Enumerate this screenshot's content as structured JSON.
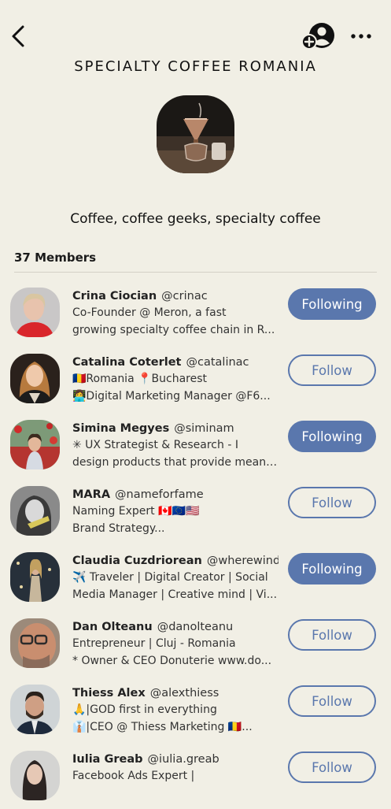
{
  "header": {
    "back_icon": "chevron-left-icon",
    "add_person_icon": "add-person-icon",
    "more_icon": "more-horizontal-icon"
  },
  "club": {
    "title": "SPECIALTY COFFEE ROMANIA",
    "description": "Coffee, coffee geeks, specialty coffee"
  },
  "members_count_label": "37 Members",
  "colors": {
    "accent": "#5a77ad",
    "background": "#f1efe5"
  },
  "members": [
    {
      "name": "Crina Ciocian",
      "handle": "@crinac",
      "bio1": "Co-Founder @ Meron, a fast",
      "bio2": "growing specialty coffee chain in R...",
      "button": "Following",
      "following": true
    },
    {
      "name": "Catalina Coterlet",
      "handle": "@catalinac",
      "bio1": "🇷🇴Romania 📍Bucharest",
      "bio2": "👩‍💻Digital Marketing Manager @F6...",
      "button": "Follow",
      "following": false
    },
    {
      "name": "Simina Megyes",
      "handle": "@siminam",
      "bio1": "✳ UX Strategist & Research - I",
      "bio2": "design products that provide meani...",
      "button": "Following",
      "following": true
    },
    {
      "name": "MARA",
      "handle": "@nameforfame",
      "bio1": "Naming Expert 🇨🇦🇪🇺🇺🇸",
      "bio2": "Brand Strategy...",
      "button": "Follow",
      "following": false
    },
    {
      "name": "Claudia Cuzdriorean",
      "handle": "@wherewinds",
      "bio1": "✈️ Traveler | Digital Creator | Social",
      "bio2": "Media Manager | Creative mind | Vi...",
      "button": "Following",
      "following": true
    },
    {
      "name": "Dan Olteanu",
      "handle": "@danolteanu",
      "bio1": "Entrepreneur | Cluj - Romania",
      "bio2": "* Owner & CEO Donuterie www.do...",
      "button": "Follow",
      "following": false
    },
    {
      "name": "Thiess Alex",
      "handle": "@alexthiess",
      "bio1": "🙏|GOD first in everything",
      "bio2": "👔|CEO @ Thiess Marketing 🇷🇴...",
      "button": "Follow",
      "following": false
    },
    {
      "name": "Iulia Greab",
      "handle": "@iulia.greab",
      "bio1": "Facebook Ads Expert |",
      "bio2": "",
      "button": "Follow",
      "following": false
    }
  ]
}
